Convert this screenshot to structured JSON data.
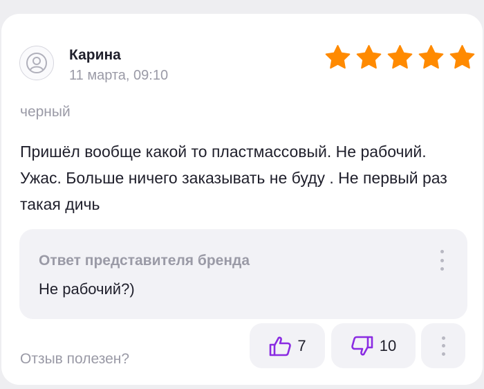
{
  "review": {
    "author": "Карина",
    "date": "11 марта, 09:10",
    "rating": 5,
    "rating_max": 5,
    "variant": "черный",
    "text": "Пришёл вообще какой то пластмассовый. Не рабочий. Ужас. Больше ничего заказывать не буду . Не первый раз такая дичь"
  },
  "brand_reply": {
    "title": "Ответ представителя бренда",
    "text": "Не рабочий?)"
  },
  "feedback": {
    "question": "Отзыв полезен?",
    "likes": "7",
    "dislikes": "10"
  },
  "colors": {
    "star": "#ff8a00",
    "vote_icon": "#8a2be2",
    "muted_text": "#9a9aa6",
    "main_text": "#1f1f2b"
  }
}
